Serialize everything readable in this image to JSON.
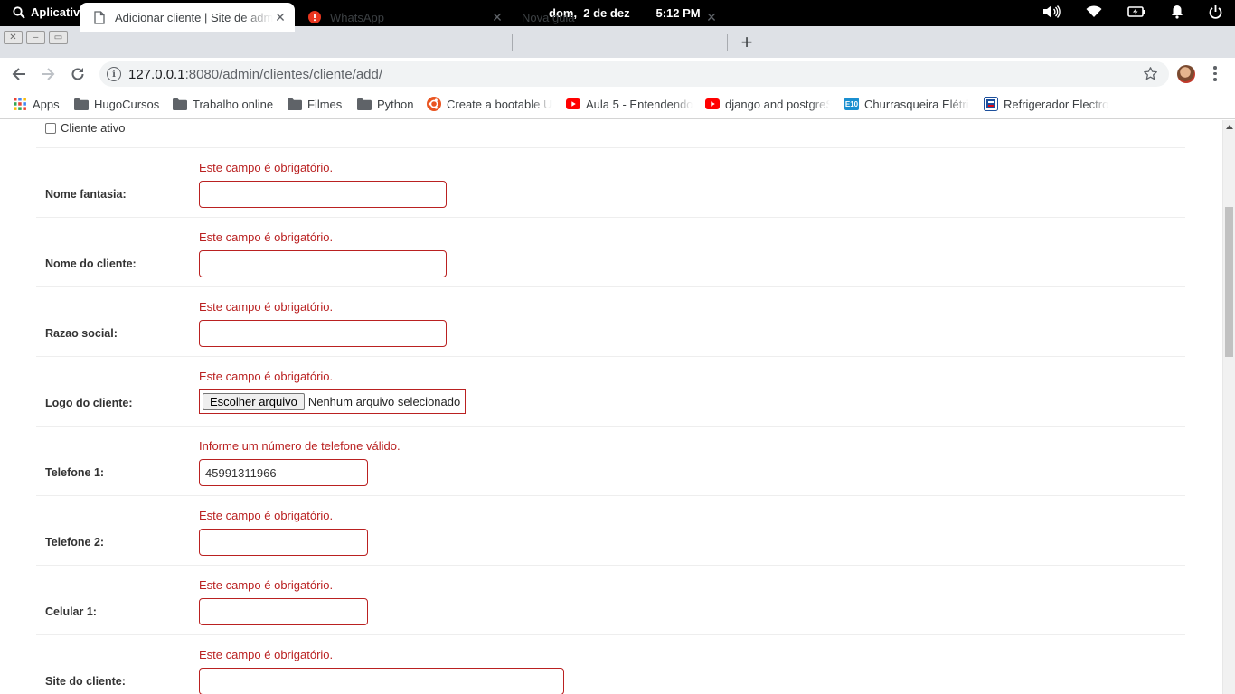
{
  "system": {
    "activities_label": "Aplicativos",
    "clock": "dom,  2 de dez        5:12 PM"
  },
  "tabs": [
    {
      "title": "Adicionar cliente | Site de admi",
      "icon": "document-icon",
      "active": true
    },
    {
      "title": "WhatsApp",
      "icon": "whatsapp-icon",
      "active": false
    },
    {
      "title": "Nova guia",
      "icon": "none",
      "active": false
    }
  ],
  "address_bar": {
    "host": "127.0.0.1",
    "path": ":8080/admin/clientes/cliente/add/"
  },
  "bookmarks": [
    {
      "label": "Apps",
      "icon": "apps-grid-icon"
    },
    {
      "label": "HugoCursos",
      "icon": "folder-icon"
    },
    {
      "label": "Trabalho online",
      "icon": "folder-icon"
    },
    {
      "label": "Filmes",
      "icon": "folder-icon"
    },
    {
      "label": "Python",
      "icon": "folder-icon"
    },
    {
      "label": "Create a bootable U",
      "icon": "ubuntu-icon"
    },
    {
      "label": "Aula 5 - Entendendo",
      "icon": "youtube-icon"
    },
    {
      "label": "django and postgreS",
      "icon": "youtube-icon"
    },
    {
      "label": "Churrasqueira Elétri",
      "icon": "e10-icon"
    },
    {
      "label": "Refrigerador Electro",
      "icon": "store-icon"
    }
  ],
  "form": {
    "active_checkbox_label": "Cliente ativo",
    "fields": [
      {
        "label": "Nome fantasia:",
        "error": "Este campo é obrigatório.",
        "value": ""
      },
      {
        "label": "Nome do cliente:",
        "error": "Este campo é obrigatório.",
        "value": ""
      },
      {
        "label": "Razao social:",
        "error": "Este campo é obrigatório.",
        "value": ""
      },
      {
        "label": "Logo do cliente:",
        "error": "Este campo é obrigatório.",
        "button": "Escolher arquivo",
        "status": "Nenhum arquivo selecionado"
      },
      {
        "label": "Telefone 1:",
        "error": "Informe um número de telefone válido.",
        "value": "45991311966"
      },
      {
        "label": "Telefone 2:",
        "error": "Este campo é obrigatório.",
        "value": ""
      },
      {
        "label": "Celular 1:",
        "error": "Este campo é obrigatório.",
        "value": ""
      },
      {
        "label": "Site do cliente:",
        "error": "Este campo é obrigatório.",
        "value": ""
      }
    ]
  },
  "colors": {
    "error": "#ba2121",
    "tabstrip": "#dee1e6",
    "omnibox": "#f1f3f4"
  }
}
